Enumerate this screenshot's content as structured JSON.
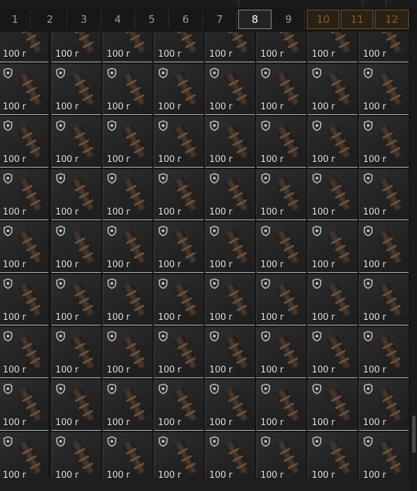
{
  "tabs": [
    {
      "label": "1",
      "state": "normal"
    },
    {
      "label": "2",
      "state": "normal"
    },
    {
      "label": "3",
      "state": "normal"
    },
    {
      "label": "4",
      "state": "normal"
    },
    {
      "label": "5",
      "state": "normal"
    },
    {
      "label": "6",
      "state": "normal"
    },
    {
      "label": "7",
      "state": "normal"
    },
    {
      "label": "8",
      "state": "active"
    },
    {
      "label": "9",
      "state": "normal"
    },
    {
      "label": "10",
      "state": "locked"
    },
    {
      "label": "11",
      "state": "locked"
    },
    {
      "label": "12",
      "state": "locked"
    }
  ],
  "grid": {
    "rows": 9,
    "columns": 8,
    "item_icon": "grenade-icon",
    "badge_icon": "shield-icon",
    "price_label": "100 r"
  },
  "colors": {
    "active_tab_border": "#8c8c8c",
    "locked_tab_text": "#7d6233",
    "locked_tab_border": "#6e5428"
  }
}
